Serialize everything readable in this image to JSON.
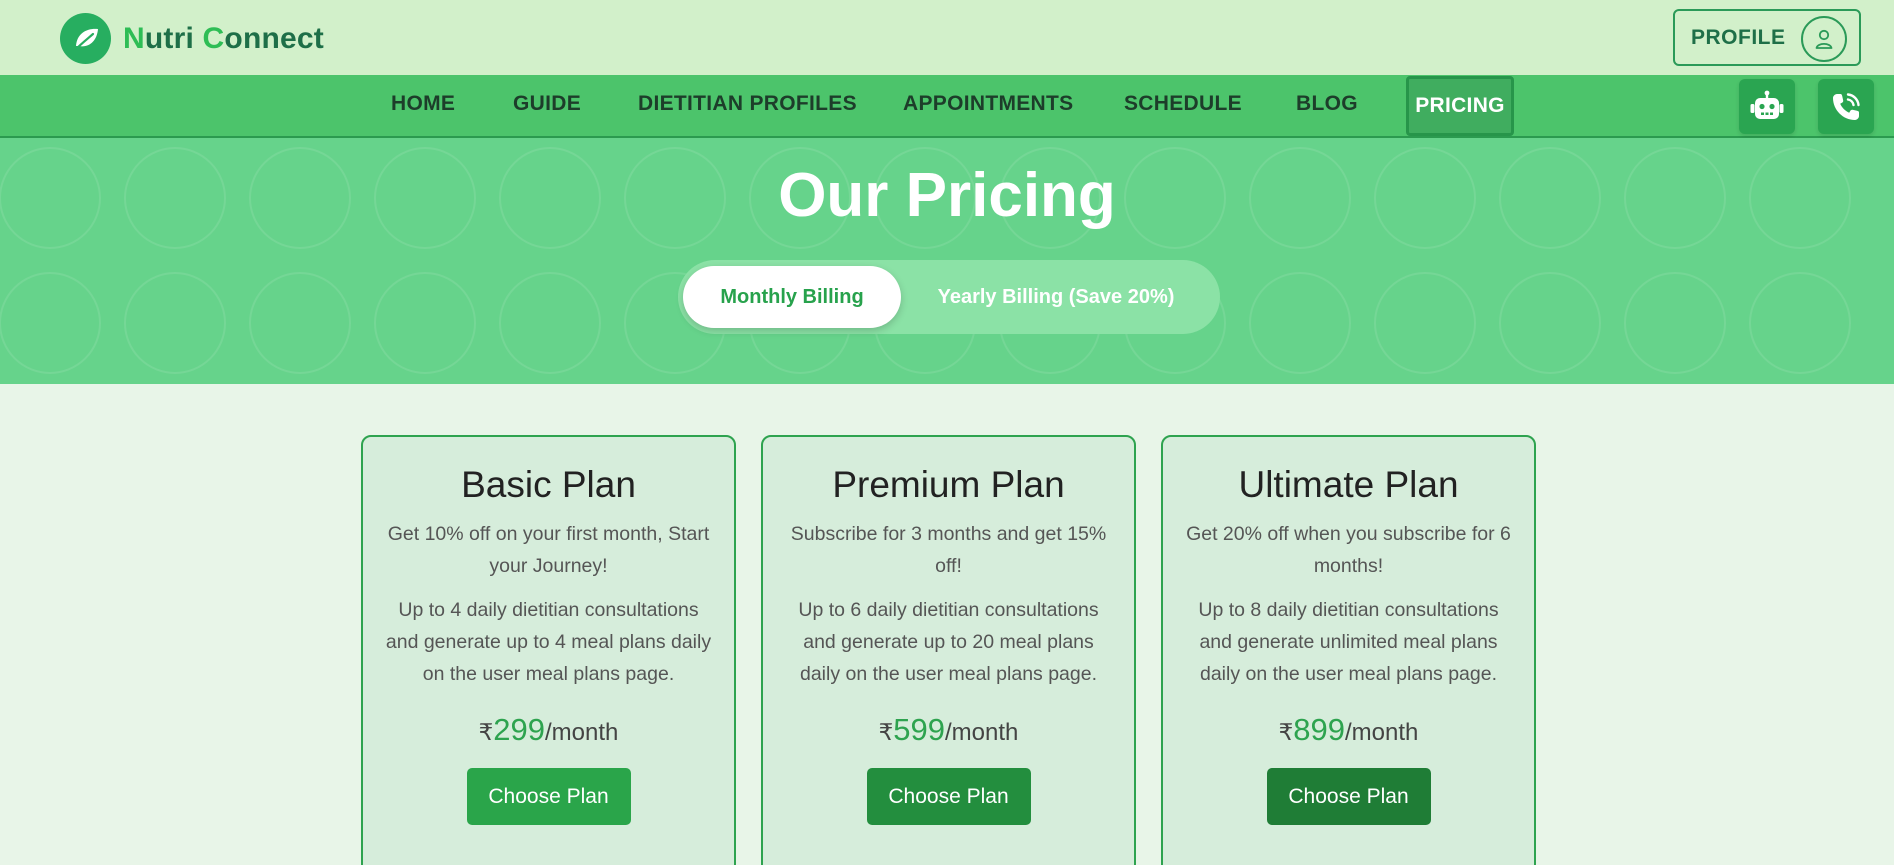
{
  "brand": {
    "name_initial_1": "N",
    "name_rest_1": "utri ",
    "name_initial_2": "C",
    "name_rest_2": "onnect"
  },
  "header": {
    "profile_label": "PROFILE"
  },
  "nav": {
    "items": [
      "HOME",
      "GUIDE",
      "DIETITIAN PROFILES",
      "APPOINTMENTS",
      "SCHEDULE",
      "BLOG",
      "PRICING"
    ],
    "active": "PRICING"
  },
  "hero": {
    "title": "Our Pricing",
    "billing_monthly": "Monthly Billing",
    "billing_yearly": "Yearly Billing (Save 20%)",
    "selected_billing": "Monthly Billing"
  },
  "plans": [
    {
      "name": "Basic Plan",
      "promo": "Get 10% off on your first month, Start your Journey!",
      "details": "Up to 4 daily dietitian consultations and generate up to 4 meal plans daily on the user meal plans page.",
      "currency": "₹",
      "amount": "299",
      "period": "/month",
      "cta": "Choose Plan",
      "cta_color": "#2aa54a"
    },
    {
      "name": "Premium Plan",
      "promo": "Subscribe for 3 months and get 15% off!",
      "details": "Up to 6 daily dietitian consultations and generate up to 20 meal plans daily on the user meal plans page.",
      "currency": "₹",
      "amount": "599",
      "period": "/month",
      "cta": "Choose Plan",
      "cta_color": "#238e3e"
    },
    {
      "name": "Ultimate Plan",
      "promo": "Get 20% off when you subscribe for 6 months!",
      "details": "Up to 8 daily dietitian consultations and generate unlimited meal plans daily on the user meal plans page.",
      "currency": "₹",
      "amount": "899",
      "period": "/month",
      "cta": "Choose Plan",
      "cta_color": "#1f7d36"
    }
  ],
  "icons": {
    "logo": "leaf-icon",
    "profile": "user-icon",
    "chatbot": "robot-icon",
    "call": "phone-call-icon"
  },
  "colors": {
    "topbar_bg": "#d2f0ca",
    "nav_bg": "#4cc46b",
    "hero_bg": "#66d38b",
    "accent_green": "#2ea34f",
    "brand_dark": "#1e6f48"
  }
}
